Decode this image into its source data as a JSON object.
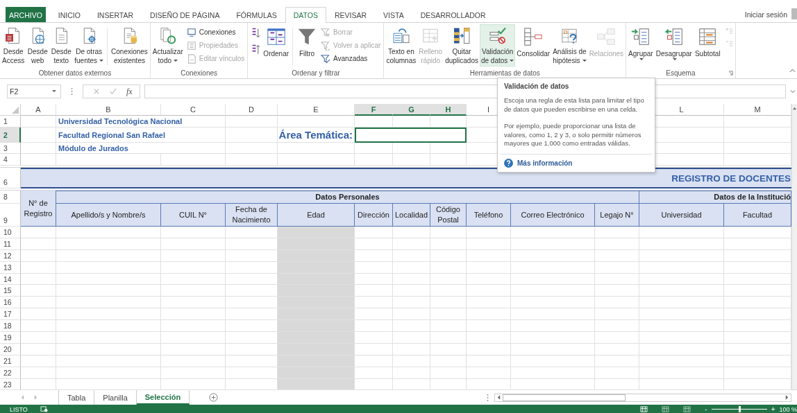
{
  "menu_tabs": [
    {
      "label": "ARCHIVO",
      "kind": "file",
      "selected": false
    },
    {
      "label": "INICIO",
      "kind": "tab",
      "selected": false
    },
    {
      "label": "INSERTAR",
      "kind": "tab",
      "selected": false
    },
    {
      "label": "DISEÑO DE PÁGINA",
      "kind": "tab",
      "selected": false
    },
    {
      "label": "FÓRMULAS",
      "kind": "tab",
      "selected": false
    },
    {
      "label": "DATOS",
      "kind": "tab",
      "selected": true
    },
    {
      "label": "REVISAR",
      "kind": "tab",
      "selected": false
    },
    {
      "label": "VISTA",
      "kind": "tab",
      "selected": false
    },
    {
      "label": "DESARROLLADOR",
      "kind": "tab",
      "selected": false
    }
  ],
  "account": "Iniciar sesión",
  "ribbon_groups": [
    {
      "label": "Obtener datos externos",
      "launcher": false,
      "items": [
        {
          "kind": "large",
          "lines": [
            "Desde",
            "Access"
          ],
          "dropdown": false,
          "disabled": false,
          "selected": false
        },
        {
          "kind": "large",
          "lines": [
            "Desde",
            "web"
          ],
          "dropdown": false,
          "disabled": false,
          "selected": false
        },
        {
          "kind": "large",
          "lines": [
            "Desde",
            "texto"
          ],
          "dropdown": false,
          "disabled": false,
          "selected": false
        },
        {
          "kind": "large",
          "lines": [
            "De otras",
            "fuentes"
          ],
          "dropdown": true,
          "disabled": false,
          "selected": false
        },
        {
          "kind": "separator"
        },
        {
          "kind": "large",
          "lines": [
            "Conexiones",
            "existentes"
          ],
          "dropdown": false,
          "disabled": false,
          "selected": false
        }
      ]
    },
    {
      "label": "Conexiones",
      "launcher": false,
      "items": [
        {
          "kind": "large",
          "lines": [
            "Actualizar",
            "todo"
          ],
          "dropdown": true,
          "disabled": false,
          "selected": false
        },
        {
          "kind": "stack",
          "entries": [
            {
              "label": "Conexiones",
              "disabled": false
            },
            {
              "label": "Propiedades",
              "disabled": true
            },
            {
              "label": "Editar vínculos",
              "disabled": true
            }
          ]
        }
      ]
    },
    {
      "label": "Ordenar y filtrar",
      "launcher": false,
      "items": [
        {
          "kind": "sort_pair"
        },
        {
          "kind": "large",
          "lines": [
            "Ordenar"
          ],
          "dropdown": false,
          "disabled": false,
          "selected": false
        },
        {
          "kind": "separator"
        },
        {
          "kind": "large",
          "lines": [
            "Filtro"
          ],
          "dropdown": false,
          "disabled": false,
          "selected": false
        },
        {
          "kind": "stack",
          "entries": [
            {
              "label": "Borrar",
              "disabled": true
            },
            {
              "label": "Volver a aplicar",
              "disabled": true
            },
            {
              "label": "Avanzadas",
              "disabled": false
            }
          ]
        }
      ]
    },
    {
      "label": "Herramientas de datos",
      "launcher": false,
      "items": [
        {
          "kind": "large",
          "lines": [
            "Texto en",
            "columnas"
          ],
          "dropdown": false,
          "disabled": false,
          "selected": false
        },
        {
          "kind": "large",
          "lines": [
            "Relleno",
            "rápido"
          ],
          "dropdown": false,
          "disabled": true,
          "selected": false
        },
        {
          "kind": "large",
          "lines": [
            "Quitar",
            "duplicados"
          ],
          "dropdown": false,
          "disabled": false,
          "selected": false
        },
        {
          "kind": "large",
          "lines": [
            "Validación",
            "de datos"
          ],
          "dropdown": true,
          "disabled": false,
          "selected": true
        },
        {
          "kind": "large",
          "lines": [
            "Consolidar"
          ],
          "dropdown": false,
          "disabled": false,
          "selected": false
        },
        {
          "kind": "large",
          "lines": [
            "Análisis de",
            "hipótesis"
          ],
          "dropdown": true,
          "disabled": false,
          "selected": false
        },
        {
          "kind": "large",
          "lines": [
            "Relaciones"
          ],
          "dropdown": false,
          "disabled": true,
          "selected": false
        }
      ]
    },
    {
      "label": "Esquema",
      "launcher": true,
      "items": [
        {
          "kind": "large",
          "lines": [
            "Agrupar"
          ],
          "dropdown": true,
          "disabled": false,
          "selected": false
        },
        {
          "kind": "large",
          "lines": [
            "Desagrupar"
          ],
          "dropdown": true,
          "disabled": false,
          "selected": false
        },
        {
          "kind": "large",
          "lines": [
            "Subtotal"
          ],
          "dropdown": false,
          "disabled": false,
          "selected": false
        },
        {
          "kind": "outline_pair"
        }
      ]
    }
  ],
  "formula_bar": {
    "name_box": "F2",
    "function_label": "fx"
  },
  "sheet": {
    "columns": [
      {
        "letter": "A",
        "selected": false
      },
      {
        "letter": "B",
        "selected": false
      },
      {
        "letter": "C",
        "selected": false
      },
      {
        "letter": "D",
        "selected": false
      },
      {
        "letter": "E",
        "selected": false
      },
      {
        "letter": "F",
        "selected": true
      },
      {
        "letter": "G",
        "selected": true
      },
      {
        "letter": "H",
        "selected": true
      },
      {
        "letter": "I",
        "selected": false
      },
      {
        "letter": "L",
        "selected": false
      },
      {
        "letter": "M",
        "selected": false
      }
    ],
    "title_rows": [
      {
        "number": "1",
        "selected": false,
        "text": "Universidad Tecnológica Nacional"
      },
      {
        "number": "2",
        "selected": true,
        "text": "Facultad Regional San Rafael"
      },
      {
        "number": "3",
        "selected": false,
        "text": "Módulo de Jurados"
      },
      {
        "number": "4",
        "selected": false
      }
    ],
    "area_label": "Área Temática:",
    "banner": {
      "number": "6",
      "text": "REGISTRO DE DOCENTES"
    },
    "table_header": {
      "numbers": [
        "8",
        "9"
      ],
      "record_heading": "N° de Registro",
      "groups": [
        "Datos Personales",
        "Datos de la Institució"
      ],
      "columns": [
        "Apellido/s y Nombre/s",
        "CUIL N°",
        "Fecha de Nacimiento",
        "Edad",
        "Dirección",
        "Localidad",
        "Código Postal",
        "Teléfono",
        "Correo Electrónico",
        "Legajo N°",
        "Universidad",
        "Facultad"
      ]
    },
    "data_rows": [
      "10",
      "11",
      "12",
      "13",
      "14",
      "15",
      "16",
      "17",
      "18",
      "19",
      "20",
      "21",
      "22",
      "23"
    ]
  },
  "tooltip": {
    "title": "Validación de datos",
    "paragraphs": [
      "Escoja una regla de esta lista para limitar el tipo de datos que pueden escribirse en una celda.",
      "Por ejemplo, puede proporcionar una lista de valores, como 1, 2 y 3, o solo permitir números mayores que 1.000 como entradas válidas."
    ],
    "link": "Más información"
  },
  "sheet_tabs": [
    {
      "label": "Tabla",
      "selected": false
    },
    {
      "label": "Planilla",
      "selected": false
    },
    {
      "label": "Selección",
      "selected": true
    }
  ],
  "status_bar": {
    "mode": "LISTO",
    "views": [
      {
        "selected": true
      },
      {
        "selected": false
      },
      {
        "selected": false
      }
    ],
    "zoom": {
      "minus": "-",
      "plus": "+",
      "level": 0.5,
      "reading": "100 %"
    }
  }
}
